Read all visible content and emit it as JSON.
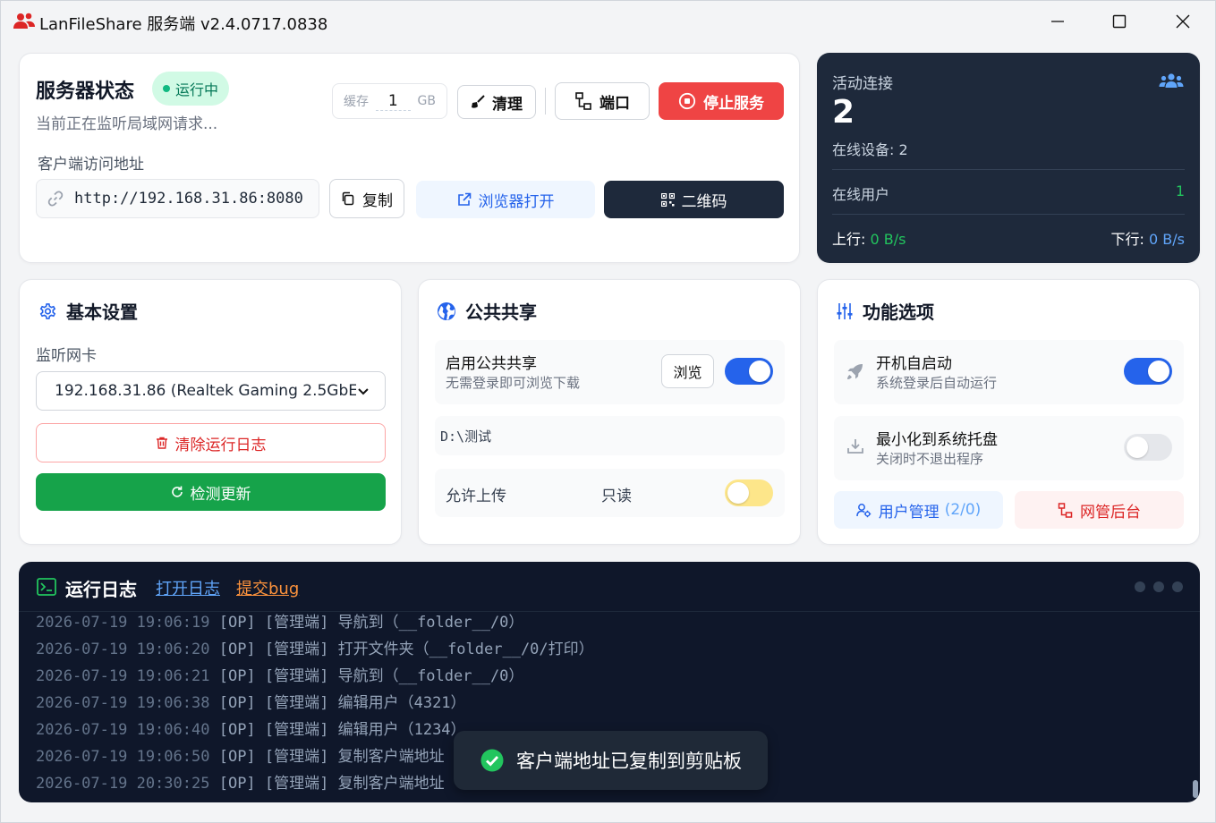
{
  "window": {
    "title": "LanFileShare 服务端 v2.4.0717.0838"
  },
  "status": {
    "title": "服务器状态",
    "badge": "运行中",
    "subtitle": "当前正在监听局域网请求...",
    "cache_label": "缓存",
    "cache_value": "1",
    "cache_unit": "GB",
    "clean_label": "清理",
    "port_label": "端口",
    "stop_label": "停止服务",
    "client_url_label": "客户端访问地址",
    "url": "http://192.168.31.86:8080",
    "copy_label": "复制",
    "open_browser_label": "浏览器打开",
    "qrcode_label": "二维码"
  },
  "activity": {
    "title": "活动连接",
    "count": "2",
    "devices": "在线设备: 2",
    "online_users_label": "在线用户",
    "online_users_value": "1",
    "up_label": "上行:",
    "up_value": "0 B/s",
    "down_label": "下行:",
    "down_value": "0 B/s"
  },
  "basic": {
    "title": "基本设置",
    "nic_label": "监听网卡",
    "nic_value": "192.168.31.86 (Realtek Gaming 2.5GbE",
    "clear_log_label": "清除运行日志",
    "check_update_label": "检测更新"
  },
  "share": {
    "title": "公共共享",
    "enable_label": "启用公共共享",
    "enable_desc": "无需登录即可浏览下载",
    "browse_label": "浏览",
    "enabled": true,
    "path": "D:\\测试",
    "upload_label": "允许上传",
    "upload_state": "只读",
    "upload_enabled": false
  },
  "features": {
    "title": "功能选项",
    "autostart_label": "开机自启动",
    "autostart_desc": "系统登录后自动运行",
    "autostart_enabled": true,
    "tray_label": "最小化到系统托盘",
    "tray_desc": "关闭时不退出程序",
    "tray_enabled": false,
    "user_mgmt_label": "用户管理",
    "user_mgmt_count": "(2/0)",
    "admin_label": "网管后台"
  },
  "log": {
    "title": "运行日志",
    "open_log_label": "打开日志",
    "submit_bug_label": "提交bug",
    "lines": [
      {
        "ts": "2026-07-19 19:06:19",
        "msg": "[OP] [管理端] 导航到（__folder__/0）"
      },
      {
        "ts": "2026-07-19 19:06:20",
        "msg": "[OP] [管理端] 打开文件夹（__folder__/0/打印）"
      },
      {
        "ts": "2026-07-19 19:06:21",
        "msg": "[OP] [管理端] 导航到（__folder__/0）"
      },
      {
        "ts": "2026-07-19 19:06:38",
        "msg": "[OP] [管理端] 编辑用户（4321）"
      },
      {
        "ts": "2026-07-19 19:06:40",
        "msg": "[OP] [管理端] 编辑用户（1234）"
      },
      {
        "ts": "2026-07-19 19:06:50",
        "msg": "[OP] [管理端] 复制客户端地址"
      },
      {
        "ts": "2026-07-19 20:30:25",
        "msg": "[OP] [管理端] 复制客户端地址"
      }
    ]
  },
  "toast": {
    "message": "客户端地址已复制到剪贴板"
  },
  "colors": {
    "accent": "#2563eb",
    "danger": "#ef4444",
    "success": "#16a34a",
    "dark_panel": "#1e293b",
    "log_bg": "#0f172a"
  }
}
